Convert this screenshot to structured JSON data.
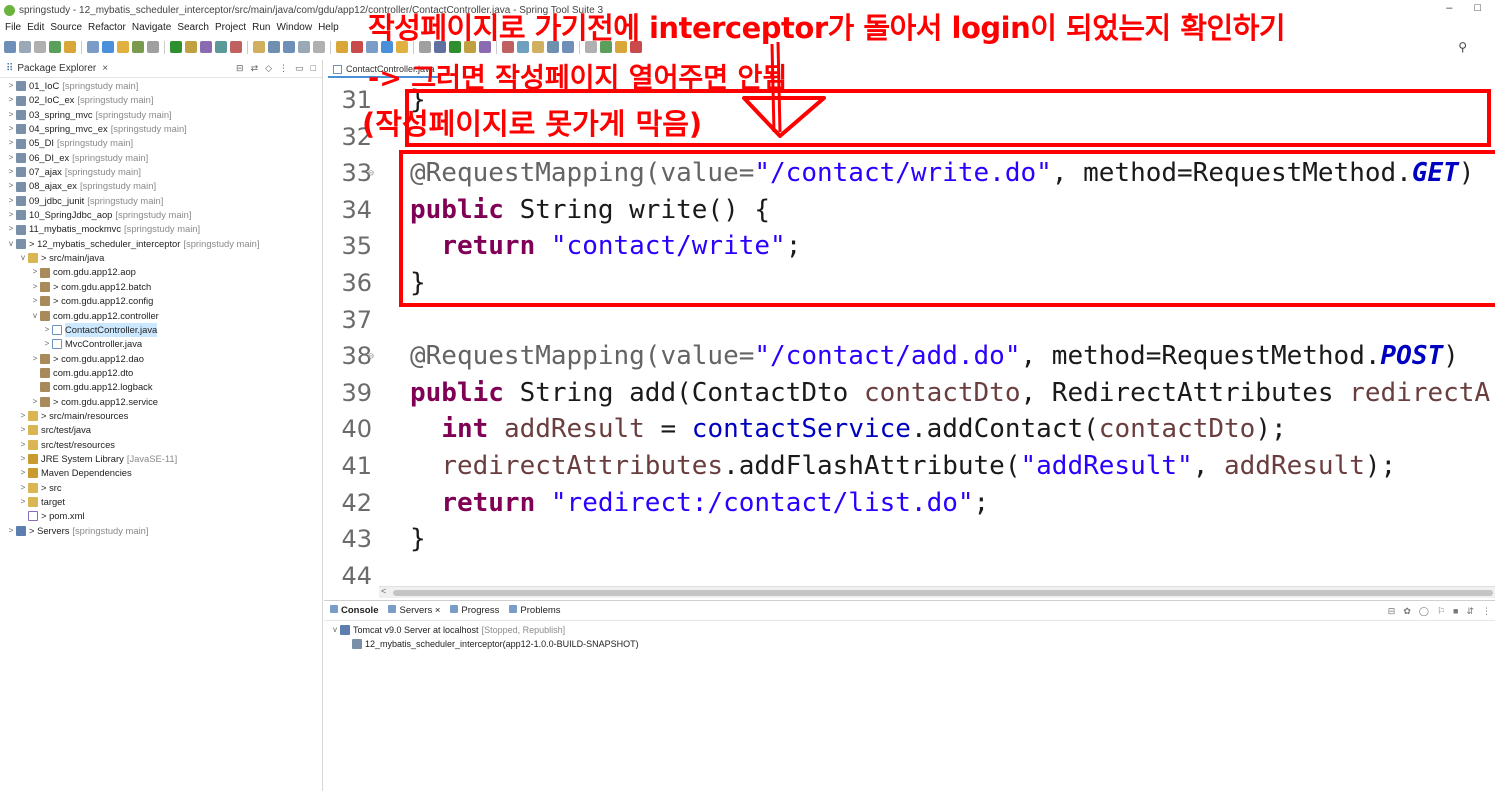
{
  "window": {
    "title": "springstudy - 12_mybatis_scheduler_interceptor/src/main/java/com/gdu/app12/controller/ContactController.java - Spring Tool Suite 3",
    "minimize": "–",
    "maximize": "□"
  },
  "menu": [
    "File",
    "Edit",
    "Source",
    "Refactor",
    "Navigate",
    "Search",
    "Project",
    "Run",
    "Window",
    "Help"
  ],
  "explorer": {
    "title": "Package Explorer",
    "close": "×",
    "tree": [
      {
        "depth": 0,
        "tw": ">",
        "icon": "project",
        "label": "01_IoC",
        "dec": "[springstudy main]"
      },
      {
        "depth": 0,
        "tw": ">",
        "icon": "project",
        "label": "02_IoC_ex",
        "dec": "[springstudy main]"
      },
      {
        "depth": 0,
        "tw": ">",
        "icon": "project",
        "label": "03_spring_mvc",
        "dec": "[springstudy main]"
      },
      {
        "depth": 0,
        "tw": ">",
        "icon": "project",
        "label": "04_spring_mvc_ex",
        "dec": "[springstudy main]"
      },
      {
        "depth": 0,
        "tw": ">",
        "icon": "project",
        "label": "05_DI",
        "dec": "[springstudy main]"
      },
      {
        "depth": 0,
        "tw": ">",
        "icon": "project",
        "label": "06_DI_ex",
        "dec": "[springstudy main]"
      },
      {
        "depth": 0,
        "tw": ">",
        "icon": "project",
        "label": "07_ajax",
        "dec": "[springstudy main]"
      },
      {
        "depth": 0,
        "tw": ">",
        "icon": "project",
        "label": "08_ajax_ex",
        "dec": "[springstudy main]"
      },
      {
        "depth": 0,
        "tw": ">",
        "icon": "project",
        "label": "09_jdbc_junit",
        "dec": "[springstudy main]"
      },
      {
        "depth": 0,
        "tw": ">",
        "icon": "project",
        "label": "10_SpringJdbc_aop",
        "dec": "[springstudy main]"
      },
      {
        "depth": 0,
        "tw": ">",
        "icon": "project",
        "label": "11_mybatis_mockmvc",
        "dec": "[springstudy main]"
      },
      {
        "depth": 0,
        "tw": "v",
        "icon": "project",
        "label": "> 12_mybatis_scheduler_interceptor",
        "dec": "[springstudy main]"
      },
      {
        "depth": 1,
        "tw": "v",
        "icon": "folder",
        "label": "> src/main/java",
        "dec": ""
      },
      {
        "depth": 2,
        "tw": ">",
        "icon": "pkg",
        "label": "com.gdu.app12.aop",
        "dec": ""
      },
      {
        "depth": 2,
        "tw": ">",
        "icon": "pkg",
        "label": "> com.gdu.app12.batch",
        "dec": ""
      },
      {
        "depth": 2,
        "tw": ">",
        "icon": "pkg",
        "label": "> com.gdu.app12.config",
        "dec": ""
      },
      {
        "depth": 2,
        "tw": "v",
        "icon": "pkg",
        "label": "com.gdu.app12.controller",
        "dec": ""
      },
      {
        "depth": 3,
        "tw": ">",
        "icon": "java",
        "label": "ContactController.java",
        "dec": "",
        "selected": true
      },
      {
        "depth": 3,
        "tw": ">",
        "icon": "java",
        "label": "MvcController.java",
        "dec": ""
      },
      {
        "depth": 2,
        "tw": ">",
        "icon": "pkg",
        "label": "> com.gdu.app12.dao",
        "dec": ""
      },
      {
        "depth": 2,
        "tw": "",
        "icon": "pkg",
        "label": "com.gdu.app12.dto",
        "dec": ""
      },
      {
        "depth": 2,
        "tw": "",
        "icon": "pkg",
        "label": "com.gdu.app12.logback",
        "dec": ""
      },
      {
        "depth": 2,
        "tw": ">",
        "icon": "pkg",
        "label": "> com.gdu.app12.service",
        "dec": ""
      },
      {
        "depth": 1,
        "tw": ">",
        "icon": "folder",
        "label": "> src/main/resources",
        "dec": ""
      },
      {
        "depth": 1,
        "tw": ">",
        "icon": "folder",
        "label": "src/test/java",
        "dec": ""
      },
      {
        "depth": 1,
        "tw": ">",
        "icon": "folder",
        "label": "src/test/resources",
        "dec": ""
      },
      {
        "depth": 1,
        "tw": ">",
        "icon": "lib",
        "label": "JRE System Library",
        "dec": "[JavaSE-11]"
      },
      {
        "depth": 1,
        "tw": ">",
        "icon": "lib",
        "label": "Maven Dependencies",
        "dec": ""
      },
      {
        "depth": 1,
        "tw": ">",
        "icon": "folder",
        "label": "> src",
        "dec": ""
      },
      {
        "depth": 1,
        "tw": ">",
        "icon": "folder",
        "label": "target",
        "dec": ""
      },
      {
        "depth": 1,
        "tw": "",
        "icon": "xml",
        "label": "> pom.xml",
        "dec": ""
      },
      {
        "depth": 0,
        "tw": ">",
        "icon": "server",
        "label": "> Servers",
        "dec": "[springstudy main]"
      }
    ]
  },
  "editor": {
    "tab": "ContactController.java",
    "lines": [
      {
        "n": "31",
        "fold": "",
        "tokens": [
          {
            "t": "}",
            "c": ""
          }
        ]
      },
      {
        "n": "32",
        "fold": "",
        "tokens": []
      },
      {
        "n": "33",
        "fold": "⊖",
        "tokens": [
          {
            "t": "@RequestMapping(value=",
            "c": "ann"
          },
          {
            "t": "\"/contact/write.do\"",
            "c": "str"
          },
          {
            "t": ", method=RequestMethod.",
            "c": ""
          },
          {
            "t": "GET",
            "c": "ital"
          },
          {
            "t": ")",
            "c": ""
          }
        ]
      },
      {
        "n": "34",
        "fold": "",
        "tokens": [
          {
            "t": "public",
            "c": "kw"
          },
          {
            "t": " String write() {",
            "c": ""
          }
        ]
      },
      {
        "n": "35",
        "fold": "",
        "tokens": [
          {
            "t": "  ",
            "c": ""
          },
          {
            "t": "return",
            "c": "kw"
          },
          {
            "t": " ",
            "c": ""
          },
          {
            "t": "\"contact/write\"",
            "c": "str"
          },
          {
            "t": ";",
            "c": ""
          }
        ]
      },
      {
        "n": "36",
        "fold": "",
        "tokens": [
          {
            "t": "}",
            "c": ""
          }
        ]
      },
      {
        "n": "37",
        "fold": "",
        "tokens": []
      },
      {
        "n": "38",
        "fold": "⊖",
        "tokens": [
          {
            "t": "@RequestMapping(value=",
            "c": "ann"
          },
          {
            "t": "\"/contact/add.do\"",
            "c": "str"
          },
          {
            "t": ", method=RequestMethod.",
            "c": ""
          },
          {
            "t": "POST",
            "c": "ital"
          },
          {
            "t": ")",
            "c": ""
          }
        ]
      },
      {
        "n": "39",
        "fold": "",
        "tokens": [
          {
            "t": "public",
            "c": "kw"
          },
          {
            "t": " String add(ContactDto ",
            "c": ""
          },
          {
            "t": "contactDto",
            "c": "param"
          },
          {
            "t": ", RedirectAttributes ",
            "c": ""
          },
          {
            "t": "redirectA",
            "c": "param"
          }
        ]
      },
      {
        "n": "40",
        "fold": "",
        "tokens": [
          {
            "t": "  ",
            "c": ""
          },
          {
            "t": "int",
            "c": "kw"
          },
          {
            "t": " ",
            "c": ""
          },
          {
            "t": "addResult",
            "c": "param"
          },
          {
            "t": " = ",
            "c": ""
          },
          {
            "t": "contactService",
            "c": "fld"
          },
          {
            "t": ".addContact(",
            "c": ""
          },
          {
            "t": "contactDto",
            "c": "param"
          },
          {
            "t": ");",
            "c": ""
          }
        ]
      },
      {
        "n": "41",
        "fold": "",
        "tokens": [
          {
            "t": "  ",
            "c": ""
          },
          {
            "t": "redirectAttributes",
            "c": "param"
          },
          {
            "t": ".addFlashAttribute(",
            "c": ""
          },
          {
            "t": "\"addResult\"",
            "c": "str"
          },
          {
            "t": ", ",
            "c": ""
          },
          {
            "t": "addResult",
            "c": "param"
          },
          {
            "t": ");",
            "c": ""
          }
        ]
      },
      {
        "n": "42",
        "fold": "",
        "tokens": [
          {
            "t": "  ",
            "c": ""
          },
          {
            "t": "return",
            "c": "kw"
          },
          {
            "t": " ",
            "c": ""
          },
          {
            "t": "\"redirect:/contact/list.do\"",
            "c": "str"
          },
          {
            "t": ";",
            "c": ""
          }
        ]
      },
      {
        "n": "43",
        "fold": "",
        "tokens": [
          {
            "t": "}",
            "c": ""
          }
        ]
      },
      {
        "n": "44",
        "fold": "",
        "tokens": []
      }
    ],
    "scroll_left": "<"
  },
  "console": {
    "tabs": [
      {
        "label": "Console",
        "active": true
      },
      {
        "label": "Servers ×",
        "active": false
      },
      {
        "label": "Progress",
        "active": false
      },
      {
        "label": "Problems",
        "active": false
      }
    ],
    "server": {
      "name": "Tomcat v9.0 Server at localhost",
      "status": "[Stopped, Republish]",
      "module": "12_mybatis_scheduler_interceptor(app12-1.0.0-BUILD-SNAPSHOT)"
    }
  },
  "annotation": {
    "line1": "작성페이지로 가기전에 interceptor가 돌아서 login이 되었는지 확인하기",
    "line2": "-> 그러면 작성페이지 열어주면 안됨",
    "line3": "(작성페이지로 못가게 막음)",
    "color": "#ff0000"
  },
  "colors": {
    "keyword": "#7f0055",
    "string": "#2a00ff",
    "field": "#0000c0",
    "annotation": "#646464",
    "selection": "#cce8ff"
  }
}
